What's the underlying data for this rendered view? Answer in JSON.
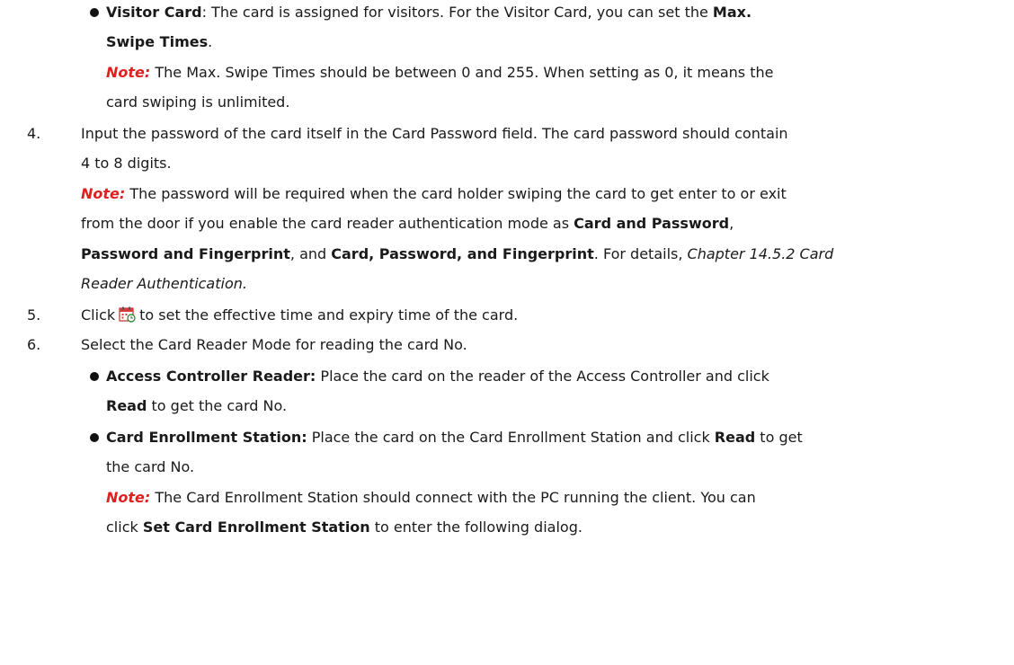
{
  "visitor": {
    "title": "Visitor Card",
    "text1": ": The card is assigned for visitors. For the Visitor Card, you can set the ",
    "bold1": "Max.",
    "bold2": "Swipe Times",
    "text2": ".",
    "note_label": "Note:",
    "note_text1": " The Max. Swipe Times should be between 0 and 255. When setting as 0, it means the",
    "note_text2": "card swiping is unlimited."
  },
  "step4": {
    "num": "4.",
    "text1": "Input the password of the card itself in the Card Password field. The card password should contain",
    "text2": "4 to 8 digits.",
    "note_label": "Note:",
    "note_text1": " The password will be required when the card holder swiping the card to get enter to or exit",
    "note_text2a": "from the door if you enable the card reader authentication mode as ",
    "bold_card_pw": "Card and Password",
    "comma1": ",",
    "bold_pw_fp": "Password and Fingerprint",
    "and": ", and ",
    "bold_card_pw_fp": "Card, Password, and Fingerprint",
    "details": ". For details, ",
    "chapter_a": "Chapter 14.5.2 Card",
    "chapter_b": "Reader Authentication."
  },
  "step5": {
    "num": "5.",
    "before": "Click",
    "after": "to set the effective time and expiry time of the card.",
    "icon": "calendar-icon"
  },
  "step6": {
    "num": "6.",
    "text": "Select the Card Reader Mode for reading the card No."
  },
  "acr": {
    "title": "Access Controller Reader:",
    "text1": " Place the card on the reader of the Access Controller and click",
    "bold_read": "Read",
    "text2": " to get the card No."
  },
  "ces": {
    "title": "Card Enrollment Station:",
    "text1": " Place the card on the Card Enrollment Station and click ",
    "bold_read": "Read",
    "text1b": " to get",
    "text2": "the card No.",
    "note_label": "Note:",
    "note_text1": " The Card Enrollment Station should connect with the PC running the client. You can",
    "note_text2a": "click ",
    "bold_set": "Set Card Enrollment Station",
    "note_text2b": " to enter the following dialog."
  }
}
